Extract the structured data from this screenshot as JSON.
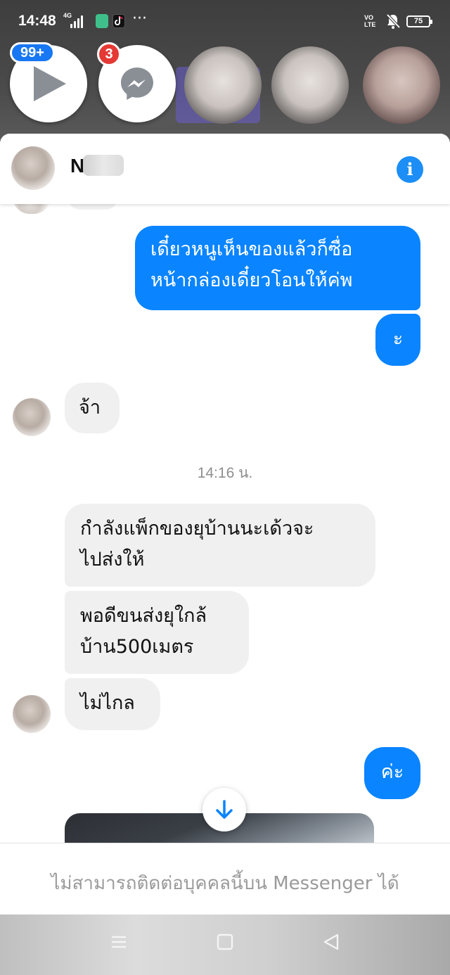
{
  "status_bar": {
    "time": "14:48",
    "network": "4G",
    "more": "···",
    "volte": "VO\nLTE",
    "battery": "75"
  },
  "chat_heads": {
    "video_badge": "99+",
    "messenger_badge": "3"
  },
  "header": {
    "contact_initial": "N"
  },
  "messages": [
    {
      "dir": "out",
      "text": "เดี๋ยวหนูเห็นของแล้วก็ซื่อ\nหน้ากล่องเดี๋ยวโอนให้ค่พ"
    },
    {
      "dir": "out",
      "text": "ะ"
    },
    {
      "dir": "in",
      "text": "จ้า"
    },
    {
      "dir": "in",
      "text": "กำลังแพ็กของยุบ้านนะเด้วจะ\nไปส่งให้"
    },
    {
      "dir": "in",
      "text": "พอดีขนส่งยุใกล้\nบ้าน500เมตร"
    },
    {
      "dir": "in",
      "text": "ไม่ไกล"
    },
    {
      "dir": "out",
      "text": "ค่ะ"
    }
  ],
  "timestamp": "14:16 น.",
  "footer": {
    "notice": "ไม่สามารถติดต่อบุคคลนี้บน Messenger ได้"
  },
  "colors": {
    "outgoing": "#0a84ff",
    "incoming": "#f0f0f0",
    "info": "#1c8ef5",
    "badge_blue": "#1877f2",
    "badge_red": "#e53935"
  }
}
